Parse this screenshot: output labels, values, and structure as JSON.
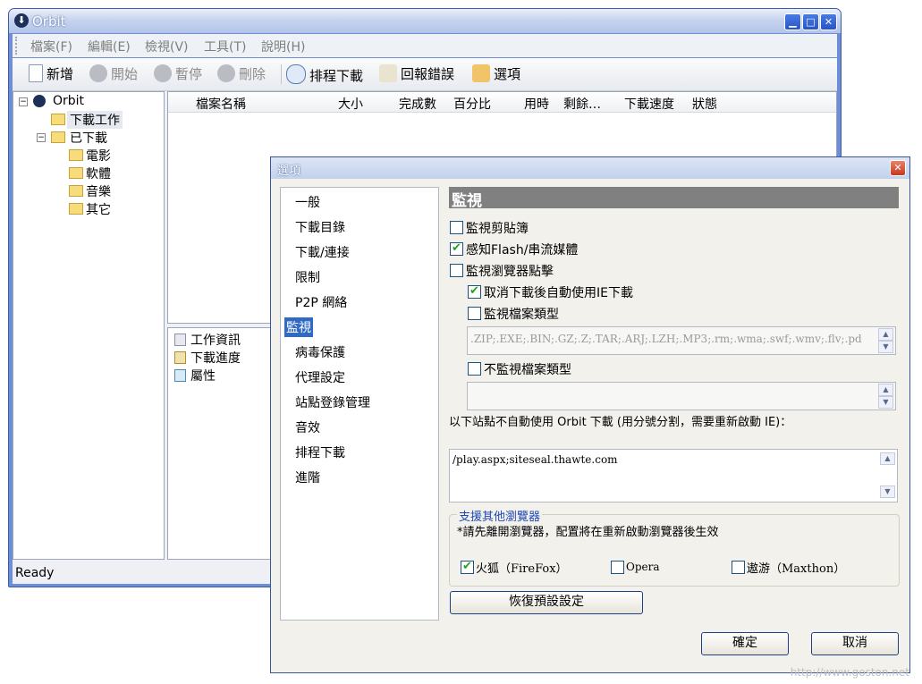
{
  "main": {
    "title": "Orbit",
    "menu": [
      "檔案(F)",
      "編輯(E)",
      "檢視(V)",
      "工具(T)",
      "說明(H)"
    ],
    "toolbar": {
      "new": "新增",
      "start": "開始",
      "pause": "暫停",
      "delete": "刪除",
      "schedule": "排程下載",
      "report": "回報錯誤",
      "options": "選項"
    },
    "tree": {
      "root": "Orbit",
      "downloading": "下載工作",
      "downloaded": "已下載",
      "children": [
        "電影",
        "軟體",
        "音樂",
        "其它"
      ]
    },
    "columns": [
      "檔案名稱",
      "大小",
      "完成數",
      "百分比",
      "用時",
      "剩餘…",
      "下載速度",
      "狀態"
    ],
    "info_tabs": [
      "工作資訊",
      "下載進度",
      "屬性"
    ],
    "status": "Ready"
  },
  "dialog": {
    "title": "選項",
    "nav": [
      "一般",
      "下載目錄",
      "下載/連接",
      "限制",
      "P2P 網絡",
      "監視",
      "病毒保護",
      "代理設定",
      "站點登錄管理",
      "音效",
      "排程下載",
      "進階"
    ],
    "selected_nav": "監視",
    "section_title": "監視",
    "opt_clipboard": "監視剪貼簿",
    "opt_flash": "感知Flash/串流媒體",
    "opt_browser": "監視瀏覽器點擊",
    "opt_cancel_ie": "取消下載後自動使用IE下載",
    "opt_filetypes": "監視檔案類型",
    "filetypes_value": ".ZIP;.EXE;.BIN;.GZ;.Z;.TAR;.ARJ;.LZH;.MP3;.rm;.wma;.swf;.wmv;.flv;.pd",
    "opt_no_filetypes": "不監視檔案類型",
    "sites_label": "以下站點不自動使用 Orbit 下載 (用分號分割，需要重新啟動 IE)：",
    "sites_value": "/play.aspx;siteseal.thawte.com",
    "group_title": "支援其他瀏覽器",
    "group_note": "*請先離開瀏覽器，配置將在重新啟動瀏覽器後生效",
    "browser_firefox": "火狐（FireFox）",
    "browser_opera": "Opera",
    "browser_maxthon": "遨游（Maxthon）",
    "restore_button": "恢復預設設定",
    "ok_button": "確定",
    "cancel_button": "取消"
  },
  "watermark": "http://www.goston.net",
  "colors": {
    "titlebar": "#2b5fd1",
    "section_header": "#808080",
    "check_green": "#21a121"
  }
}
